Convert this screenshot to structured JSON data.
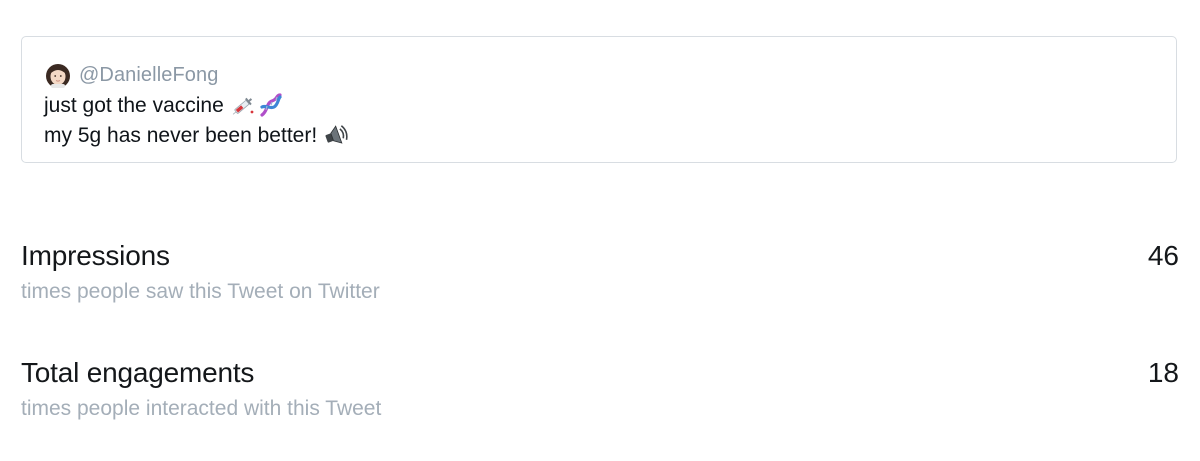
{
  "tweet": {
    "handle": "@DanielleFong",
    "line1": "just got the vaccine",
    "line2": "my 5g has never been better!",
    "icons": {
      "avatar": "woman-emoji-icon",
      "line1_emojis": [
        "syringe-icon",
        "dna-icon"
      ],
      "line2_emoji": "speaker-icon"
    }
  },
  "metrics": [
    {
      "title": "Impressions",
      "subtitle": "times people saw this Tweet on Twitter",
      "value": "46"
    },
    {
      "title": "Total engagements",
      "subtitle": "times people interacted with this Tweet",
      "value": "18"
    }
  ],
  "colors": {
    "border": "#d8dde2",
    "muted_text": "#a4aeb8",
    "handle_text": "#8b98a5",
    "primary_text": "#14171a"
  }
}
